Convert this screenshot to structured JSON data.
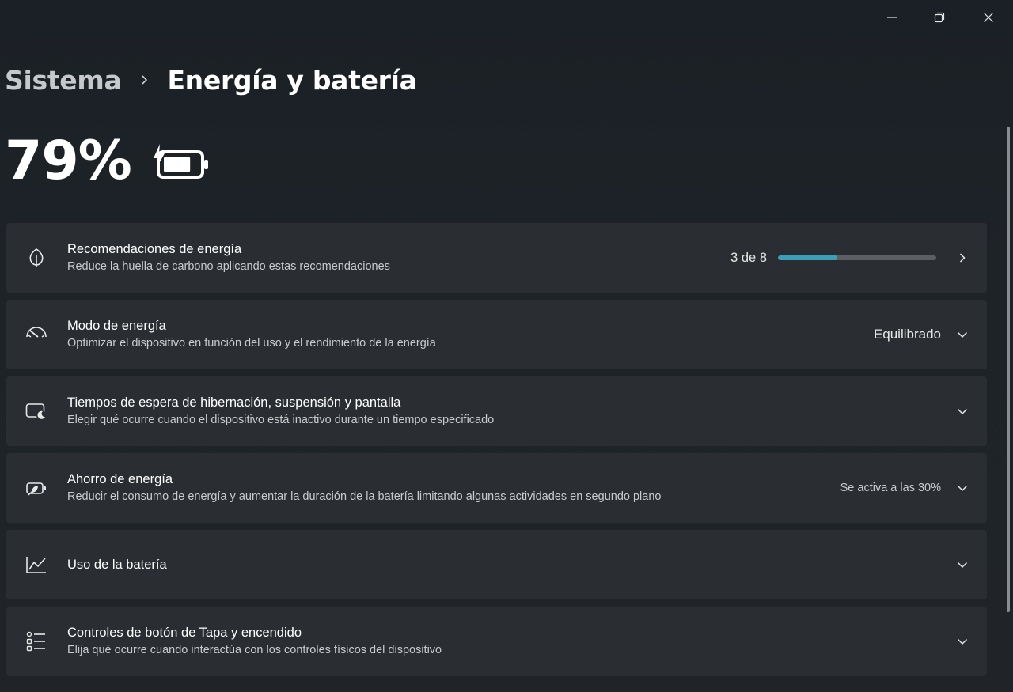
{
  "window": {
    "minimize_icon": "minimize-icon",
    "maximize_icon": "restore-icon",
    "close_icon": "close-icon"
  },
  "breadcrumb": {
    "parent": "Sistema",
    "separator_icon": "chevron-right-icon",
    "current": "Energía y batería"
  },
  "battery": {
    "percent": "79%",
    "icon": "battery-charging-icon",
    "level": 0.79
  },
  "cards": {
    "recommendations": {
      "icon": "leaf-icon",
      "title": "Recomendaciones de energía",
      "subtitle": "Reduce la huella de carbono aplicando estas recomendaciones",
      "count": "3 de 8",
      "progress": 0.375
    },
    "power_mode": {
      "icon": "gauge-icon",
      "title": "Modo de energía",
      "subtitle": "Optimizar el dispositivo en función del uso y el rendimiento de la energía",
      "value": "Equilibrado"
    },
    "timeouts": {
      "icon": "screen-sleep-icon",
      "title": "Tiempos de espera de hibernación, suspensión y pantalla",
      "subtitle": "Elegir qué ocurre cuando el dispositivo está inactivo durante un tiempo especificado"
    },
    "saver": {
      "icon": "battery-saver-icon",
      "title": "Ahorro de energía",
      "subtitle": "Reducir el consumo de energía y aumentar la duración de la batería limitando algunas actividades en segundo plano",
      "value": "Se activa a las 30%"
    },
    "usage": {
      "icon": "chart-line-icon",
      "title": "Uso de la batería"
    },
    "lid": {
      "icon": "list-settings-icon",
      "title": "Controles de botón de Tapa y encendido",
      "subtitle": "Elija qué ocurre cuando interactúa con los controles físicos del dispositivo"
    }
  },
  "colors": {
    "background": "#1d2329",
    "card": "#2a2e32",
    "accent": "#3b9fb7",
    "track": "#5b5f63"
  }
}
